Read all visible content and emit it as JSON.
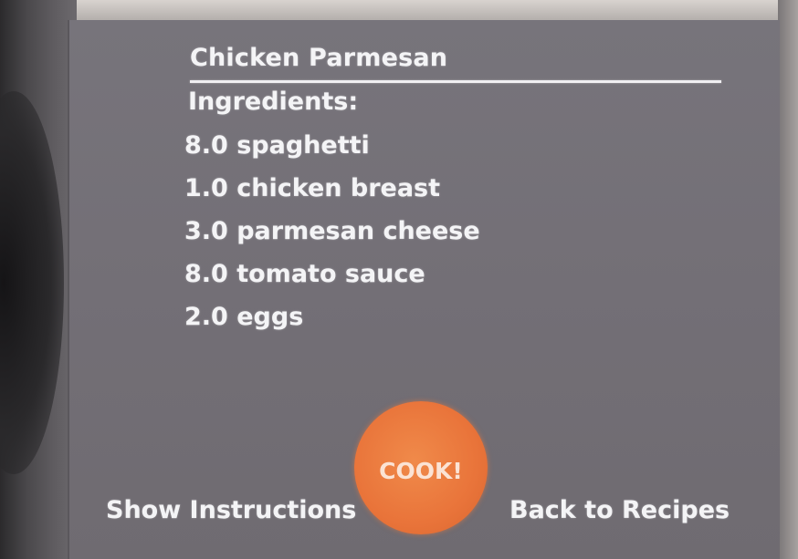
{
  "recipe": {
    "title": "Chicken Parmesan",
    "ingredients_heading": "Ingredients:",
    "ingredients": [
      "8.0 spaghetti",
      "1.0 chicken breast",
      "3.0 parmesan cheese",
      "8.0 tomato sauce",
      "2.0 eggs"
    ]
  },
  "actions": {
    "cook_label": "COOK!",
    "show_instructions_label": "Show Instructions",
    "back_to_recipes_label": "Back to Recipes"
  },
  "colors": {
    "screen_background": "#736f76",
    "text": "#f4f4f6",
    "cook_button": "#e9743a"
  }
}
